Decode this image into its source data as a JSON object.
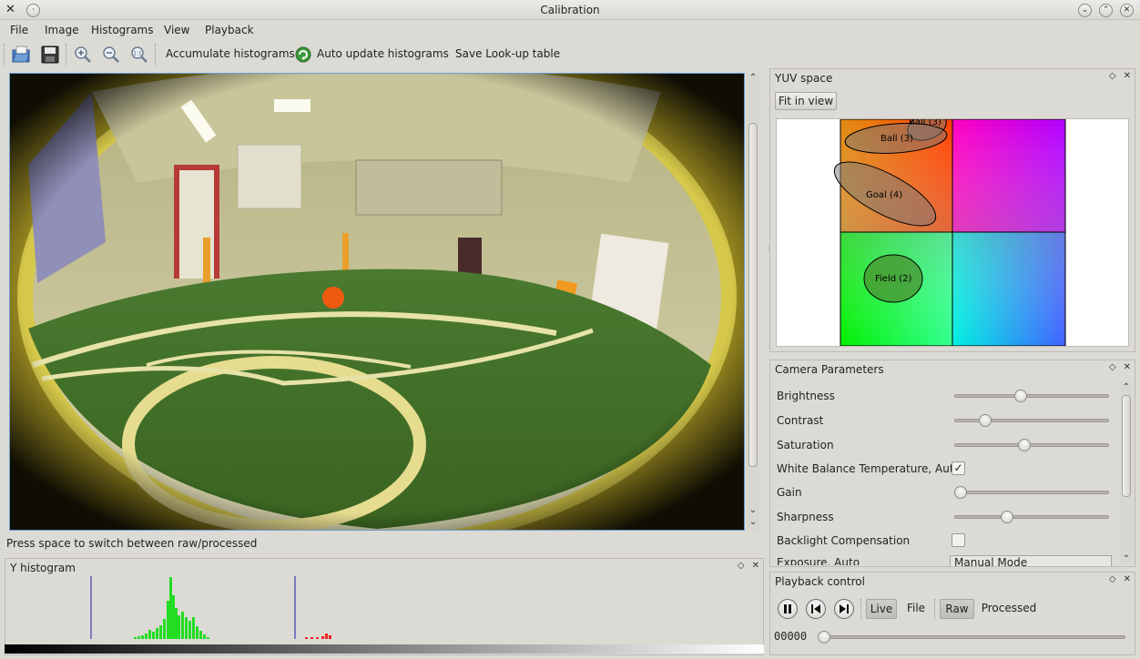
{
  "window": {
    "title": "Calibration"
  },
  "menu": [
    "File",
    "Image",
    "Histograms",
    "View",
    "Playback"
  ],
  "toolbar": {
    "accumulate": "Accumulate histograms",
    "auto_update": "Auto update histograms",
    "save_lut": "Save Look-up table"
  },
  "status": "Press space to switch between raw/processed",
  "yuv": {
    "title": "YUV space",
    "fit_button": "Fit in view",
    "regions": [
      "Ball (3)",
      "Ball (3)",
      "Goal (4)",
      "Field (2)"
    ]
  },
  "camera": {
    "title": "Camera Parameters",
    "params": [
      {
        "label": "Brightness",
        "type": "slider",
        "value": 0.42
      },
      {
        "label": "Contrast",
        "type": "slider",
        "value": 0.17
      },
      {
        "label": "Saturation",
        "type": "slider",
        "value": 0.45
      },
      {
        "label": "White Balance Temperature, Auto",
        "type": "checkbox",
        "checked": true
      },
      {
        "label": "Gain",
        "type": "slider",
        "value": 0.0
      },
      {
        "label": "Sharpness",
        "type": "slider",
        "value": 0.33
      },
      {
        "label": "Backlight Compensation",
        "type": "checkbox",
        "checked": false
      }
    ],
    "partial_label": "Exposure, Auto",
    "partial_value": "Manual Mode"
  },
  "playback": {
    "title": "Playback control",
    "live": "Live",
    "file": "File",
    "raw": "Raw",
    "processed": "Processed",
    "frame": "00000"
  },
  "histogram": {
    "title": "Y histogram"
  },
  "colors": {
    "accent": "#6b9bd1",
    "hist_green": "#22dd22",
    "hist_red": "#ee2222",
    "marker": "#1a1ab0"
  }
}
